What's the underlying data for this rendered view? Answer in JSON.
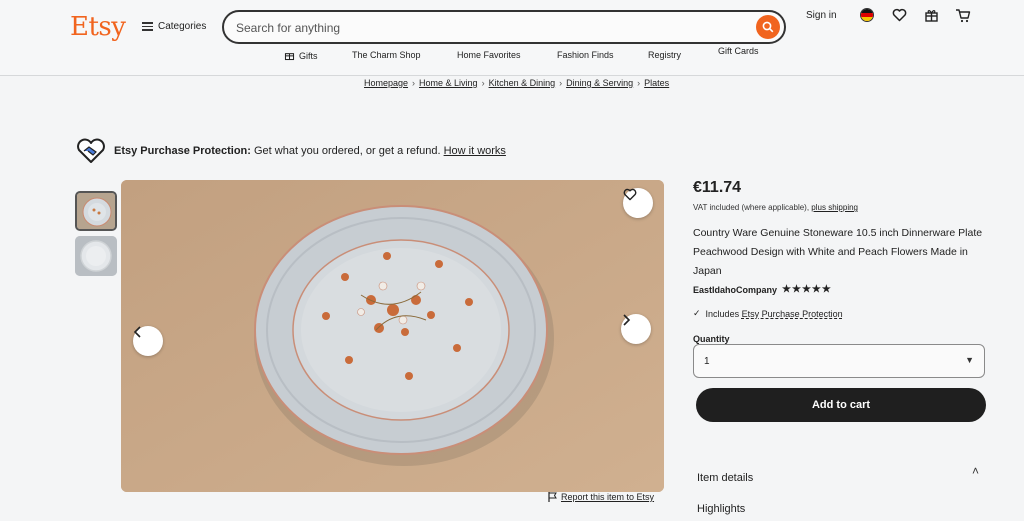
{
  "header": {
    "logo": "Etsy",
    "categories_label": "Categories",
    "search_placeholder": "Search for anything",
    "signin_label": "Sign in"
  },
  "nav": {
    "items": [
      "Gifts",
      "The Charm Shop",
      "Home Favorites",
      "Fashion Finds",
      "Registry",
      "Gift Cards"
    ]
  },
  "breadcrumb": [
    "Homepage",
    "Home & Living",
    "Kitchen & Dining",
    "Dining & Serving",
    "Plates"
  ],
  "protection": {
    "bold": "Etsy Purchase Protection:",
    "text": "Get what you ordered, or get a refund.",
    "link": "How it works"
  },
  "listing": {
    "price": "€11.74",
    "vat_text": "VAT included (where applicable),",
    "vat_link": "plus shipping",
    "title": "Country Ware Genuine Stoneware 10.5 inch Dinnerware Plate Peachwood Design with White and Peach Flowers Made in Japan",
    "shop_name": "EastIdahoCompany",
    "stars": "★★★★★",
    "rating": 5,
    "includes_prefix": "Includes",
    "includes_link": "Etsy Purchase Protection",
    "quantity_label": "Quantity",
    "quantity_value": "1",
    "add_to_cart": "Add to cart",
    "item_details": "Item details",
    "highlights": "Highlights",
    "report_link": "Report this item to Etsy"
  },
  "colors": {
    "brand": "#f1641e",
    "button_dark": "#1f1f1f"
  }
}
